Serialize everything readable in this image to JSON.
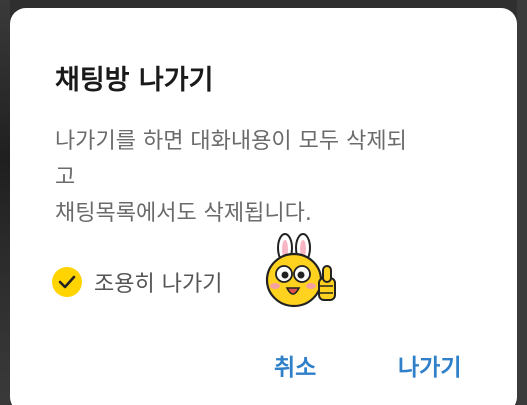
{
  "dialog": {
    "title": "채팅방 나가기",
    "message_lines": [
      "나가기를 하면 대화내용이 모두 삭제되",
      "고",
      "채팅목록에서도 삭제됩니다."
    ],
    "silent_leave": {
      "label": "조용히 나가기",
      "checked": true
    },
    "emoticon": "yellow-character-thumbs-up-icon",
    "buttons": {
      "cancel": "취소",
      "leave": "나가기"
    }
  },
  "colors": {
    "accent": "#2f80c9",
    "checkbox": "#ffd400",
    "title": "#1a1a1a",
    "message": "#6b6b6b"
  }
}
